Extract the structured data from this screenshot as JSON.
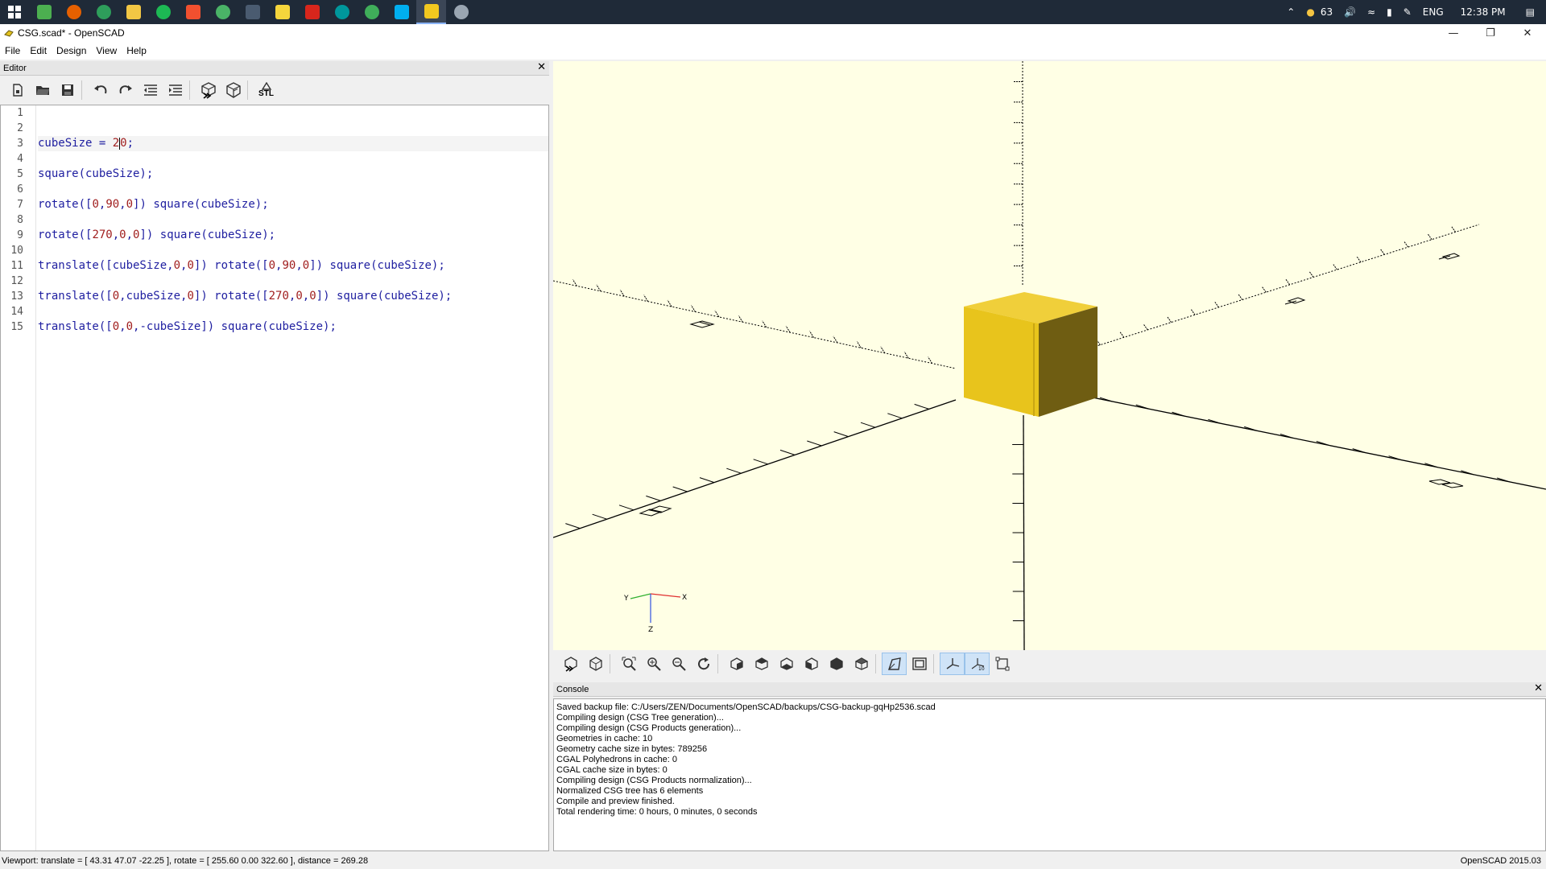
{
  "taskbar": {
    "apps": [
      {
        "name": "gmail-icon",
        "color": "#4caf50"
      },
      {
        "name": "firefox-icon",
        "color": "#e66000"
      },
      {
        "name": "chrome-icon",
        "color": "#2e9e5b"
      },
      {
        "name": "file-explorer-icon",
        "color": "#f2c744"
      },
      {
        "name": "spotify-icon",
        "color": "#1db954"
      },
      {
        "name": "git-icon",
        "color": "#f1502f"
      },
      {
        "name": "pushbullet-icon",
        "color": "#4ab367"
      },
      {
        "name": "media-player-icon",
        "color": "#4a5b70"
      },
      {
        "name": "sticky-notes-icon",
        "color": "#f5d53c"
      },
      {
        "name": "acrobat-icon",
        "color": "#d8261c"
      },
      {
        "name": "arduino-icon",
        "color": "#00979c"
      },
      {
        "name": "chrome-app-icon",
        "color": "#3fae5a"
      },
      {
        "name": "skype-icon",
        "color": "#00aff0"
      },
      {
        "name": "openscad-icon",
        "color": "#f2c81f"
      },
      {
        "name": "globe-icon",
        "color": "#9aa6b2"
      }
    ],
    "tray": {
      "temperature": "63",
      "language": "ENG",
      "time": "12:38 PM"
    }
  },
  "window": {
    "title": "CSG.scad* - OpenSCAD"
  },
  "menu": {
    "items": [
      "File",
      "Edit",
      "Design",
      "View",
      "Help"
    ]
  },
  "editor": {
    "header": "Editor",
    "toolbar_stl_label": "STL",
    "lines": [
      {
        "n": "1",
        "text": ""
      },
      {
        "n": "2",
        "text": ""
      },
      {
        "n": "3",
        "text": "cubeSize = 20;"
      },
      {
        "n": "4",
        "text": ""
      },
      {
        "n": "5",
        "text": "square(cubeSize);"
      },
      {
        "n": "6",
        "text": ""
      },
      {
        "n": "7",
        "text": "rotate([0,90,0]) square(cubeSize);"
      },
      {
        "n": "8",
        "text": ""
      },
      {
        "n": "9",
        "text": "rotate([270,0,0]) square(cubeSize);"
      },
      {
        "n": "10",
        "text": ""
      },
      {
        "n": "11",
        "text": "translate([cubeSize,0,0]) rotate([0,90,0]) square(cubeSize);"
      },
      {
        "n": "12",
        "text": ""
      },
      {
        "n": "13",
        "text": "translate([0,cubeSize,0]) rotate([270,0,0]) square(cubeSize);"
      },
      {
        "n": "14",
        "text": ""
      },
      {
        "n": "15",
        "text": "translate([0,0,-cubeSize]) square(cubeSize);"
      }
    ]
  },
  "viewport": {
    "background": "#ffffe5",
    "cube_front": "#e8c41c",
    "cube_top": "#f0cf3a",
    "cube_side": "#6f5d12",
    "axis_labels": {
      "x": "X",
      "y": "Y",
      "z": "Z"
    }
  },
  "console": {
    "header": "Console",
    "lines": [
      "Saved backup file: C:/Users/ZEN/Documents/OpenSCAD/backups/CSG-backup-gqHp2536.scad",
      "Compiling design (CSG Tree generation)...",
      "Compiling design (CSG Products generation)...",
      "Geometries in cache: 10",
      "Geometry cache size in bytes: 789256",
      "CGAL Polyhedrons in cache: 0",
      "CGAL cache size in bytes: 0",
      "Compiling design (CSG Products normalization)...",
      "Normalized CSG tree has 6 elements",
      "Compile and preview finished.",
      "Total rendering time: 0 hours, 0 minutes, 0 seconds"
    ]
  },
  "status": {
    "viewport": "Viewport: translate = [ 43.31 47.07 -22.25 ], rotate = [ 255.60 0.00 322.60 ], distance = 269.28",
    "version": "OpenSCAD 2015.03"
  }
}
